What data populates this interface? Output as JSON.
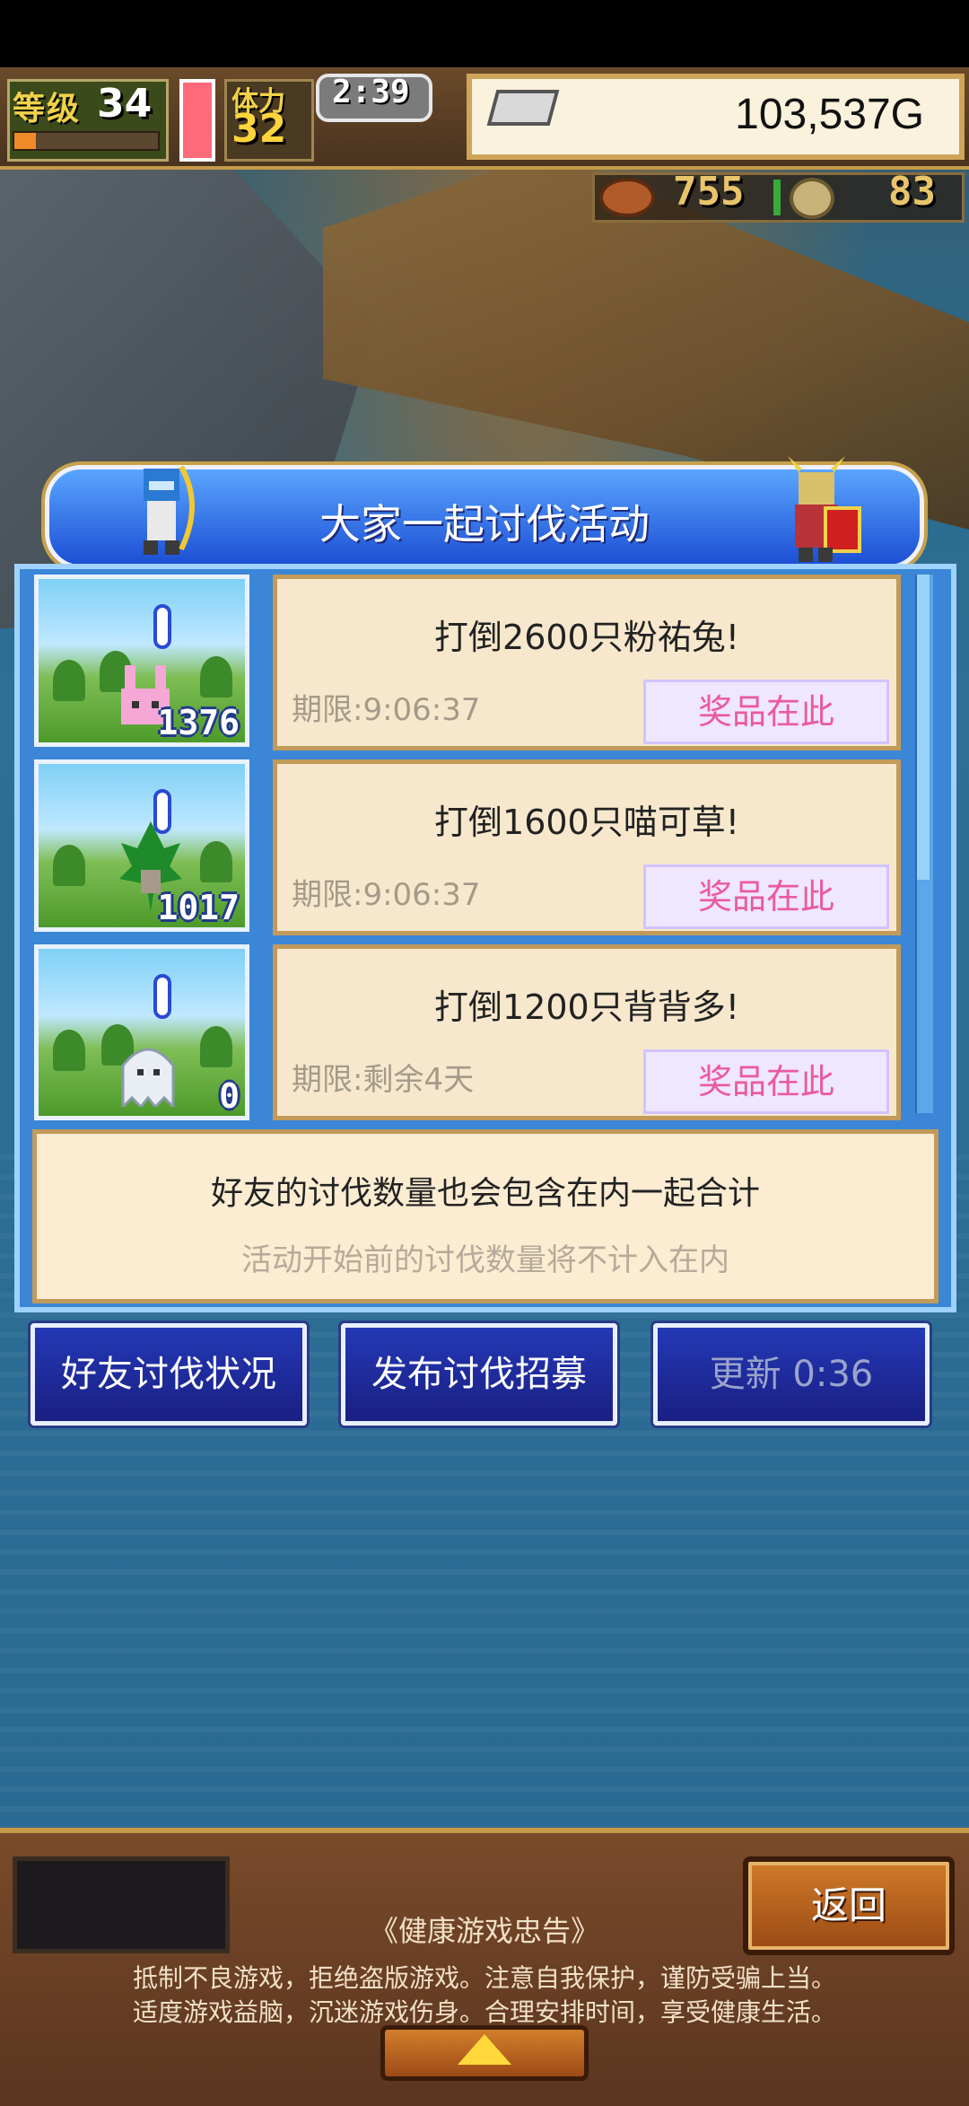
{
  "hud": {
    "level_label": "等级",
    "level_value": "34",
    "exp_progress": 0.15,
    "stamina_label": "体力",
    "stamina_value": "32",
    "timer": "2:39",
    "gold": "103,537G",
    "food": "755",
    "medals": "83"
  },
  "dialog": {
    "title": "大家一起讨伐活动",
    "events": [
      {
        "title": "打倒2600只粉祐兔!",
        "deadline": "期限:9:06:37",
        "prize_label": "奖品在此",
        "count": "1376",
        "monster": "pink-rabbit-icon"
      },
      {
        "title": "打倒1600只喵可草!",
        "deadline": "期限:9:06:37",
        "prize_label": "奖品在此",
        "count": "1017",
        "monster": "grass-monster-icon"
      },
      {
        "title": "打倒1200只背背多!",
        "deadline": "期限:剩余4天",
        "prize_label": "奖品在此",
        "count": "0",
        "monster": "ghost-monster-icon"
      }
    ],
    "note": "好友的讨伐数量也会包含在内一起合计",
    "note_sub": "活动开始前的讨伐数量将不计入在内"
  },
  "actions": {
    "friends_status": "好友讨伐状况",
    "post_recruit": "发布讨伐招募",
    "refresh": "更新 0:36"
  },
  "bottom": {
    "back_label": "返回",
    "advice_title": "《健康游戏忠告》",
    "advice_line1": "抵制不良游戏，拒绝盗版游戏。注意自我保护，谨防受骗上当。",
    "advice_line2": "适度游戏益脑，沉迷游戏伤身。合理安排时间，享受健康生活。"
  },
  "colors": {
    "title_blue": "#1c4fd4",
    "prize_pink": "#ea5a9f",
    "card_bg": "#f7e8cd",
    "button_blue": "#1a1f82"
  }
}
